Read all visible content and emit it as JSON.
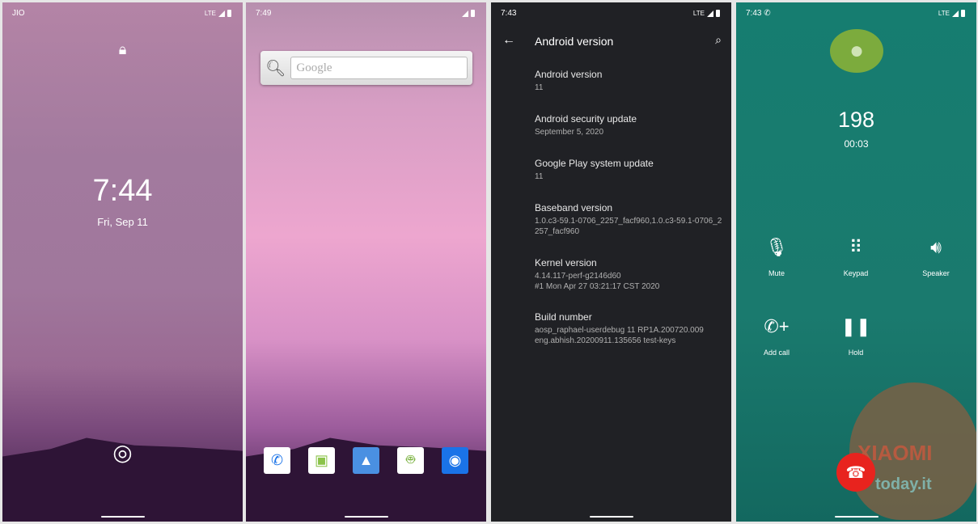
{
  "lock": {
    "carrier": "JIO",
    "network": "LTE",
    "time": "7:44",
    "date": "Fri, Sep 11"
  },
  "home": {
    "status_time": "7:49",
    "search_placeholder": "Google",
    "dock": [
      "phone",
      "messaging",
      "gallery",
      "android",
      "camera"
    ]
  },
  "about": {
    "status_time": "7:43",
    "network": "LTE",
    "title": "Android version",
    "items": [
      {
        "title": "Android version",
        "value": "11"
      },
      {
        "title": "Android security update",
        "value": "September 5, 2020"
      },
      {
        "title": "Google Play system update",
        "value": "11"
      },
      {
        "title": "Baseband version",
        "value": "1.0.c3-59.1-0706_2257_facf960,1.0.c3-59.1-0706_2257_facf960"
      },
      {
        "title": "Kernel version",
        "value": "4.14.117-perf-g2146d60\n#1 Mon Apr 27 03:21:17 CST 2020"
      },
      {
        "title": "Build number",
        "value": "aosp_raphael-userdebug 11 RP1A.200720.009\neng.abhish.20200911.135656 test-keys"
      }
    ]
  },
  "call": {
    "status_time": "7:43",
    "network": "LTE",
    "number": "198",
    "duration": "00:03",
    "buttons": {
      "mute": "Mute",
      "keypad": "Keypad",
      "speaker": "Speaker",
      "add_call": "Add call",
      "hold": "Hold"
    },
    "end_color": "#e8231e",
    "avatar_color": "#7cab3d"
  },
  "watermark": {
    "brand": "XIAOMI",
    "site": "today.it"
  }
}
